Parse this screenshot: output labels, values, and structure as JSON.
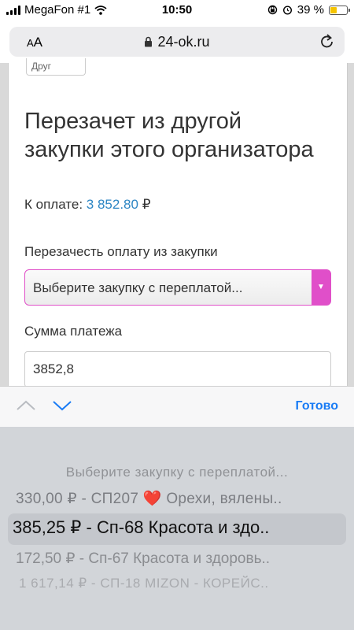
{
  "status_bar": {
    "carrier": "MegaFon #1",
    "time": "10:50",
    "battery": "39 %",
    "battery_level": 0.39
  },
  "browser": {
    "text_size_label": "AA",
    "url": "24-ok.ru"
  },
  "form": {
    "stub_text": "Друг",
    "heading": "Перезачет из другой закупки этого организатора",
    "payment_label": "К оплате:",
    "payment_amount": "3 852.80",
    "currency": "₽",
    "offset_label": "Перезачесть оплату из закупки",
    "select_value": "Выберите закупку с переплатой...",
    "sum_label": "Сумма платежа",
    "sum_value": "3852,8"
  },
  "accessory": {
    "done_label": "Готово"
  },
  "picker": {
    "items": [
      "Выберите закупку с переплатой...",
      "330,00 ₽ - СП207 ❤️ Орехи, вялены..",
      "385,25 ₽ - Сп-68 Красота и здо..",
      "172,50 ₽ - Сп-67 Красота и здоровь..",
      "1 617,14 ₽ - СП-18 MIZON - КОРЕЙС.."
    ],
    "selected_index": 2
  },
  "colors": {
    "accent_link": "#2d86c4",
    "select_border": "#e050c8",
    "done_blue": "#1a7cf5"
  }
}
